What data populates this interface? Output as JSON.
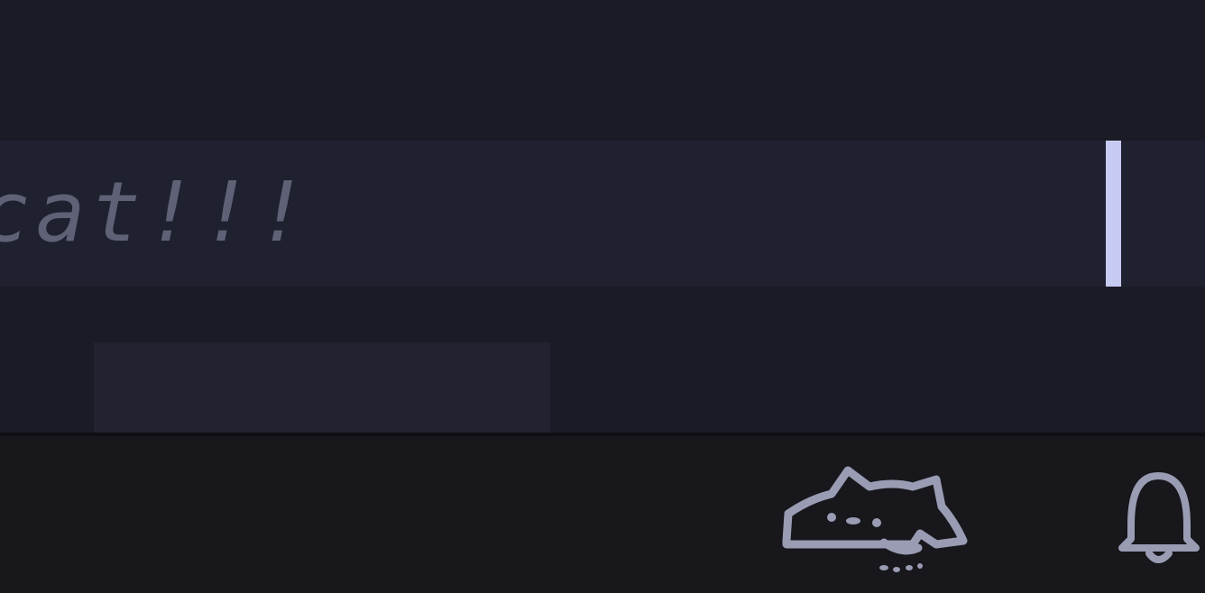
{
  "message_input": {
    "visible_text": "cat!!!"
  },
  "icons": {
    "cat": "bongo-cat-icon",
    "bell": "bell-icon"
  },
  "colors": {
    "background": "#1b1b26",
    "input_row": "#1f2130",
    "text": "#5f6276",
    "caret": "#c7cbf2",
    "bottom_bar": "#17171c",
    "icon_stroke": "#9a9cb4"
  }
}
